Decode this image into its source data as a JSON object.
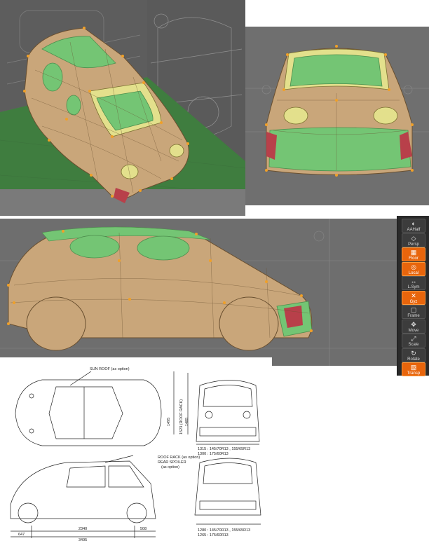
{
  "tool_shelf": {
    "items": [
      {
        "label": "AAHalf",
        "icon": "half-icon"
      },
      {
        "label": "Persp",
        "icon": "perspective-icon"
      },
      {
        "label": "Floor",
        "icon": "floor-icon",
        "active": true
      },
      {
        "label": "Local",
        "icon": "local-icon",
        "active": true
      },
      {
        "label": "L.Sym",
        "icon": "symmetry-icon"
      },
      {
        "label": "Gyz",
        "icon": "axis-icon",
        "active": true
      },
      {
        "label": "Frame",
        "icon": "frame-icon"
      },
      {
        "label": "Move",
        "icon": "move-icon"
      },
      {
        "label": "Scale",
        "icon": "scale-icon"
      },
      {
        "label": "Rotate",
        "icon": "rotate-icon"
      },
      {
        "label": "Transp",
        "icon": "transparency-icon",
        "active": true
      }
    ]
  },
  "reference_drawing": {
    "labels": {
      "sun_roof": "SUN ROOF (as option)",
      "roof_rack": "ROOF RACK (as option)",
      "rear_spoiler": "REAR SPOILER",
      "rear_spoiler_note": "(as option)"
    },
    "dimensions": {
      "height_1": "1495",
      "height_2": "1523 (ROOF RACK)",
      "height_3": "1485",
      "front_track_1": "1315 : 145/70R13 , 155/65R13",
      "front_track_2": "1300 : 175/60R13",
      "rear_track_1": "1280 : 145/70R13 , 155/65R13",
      "rear_track_2": "1265 : 175/60R13",
      "front_overhang": "647",
      "wheelbase": "2340",
      "rear_overhang": "508",
      "overall_length": "3495"
    }
  },
  "colors": {
    "viewport_bg": "#6e6e6e",
    "floor_green": "#3f7d3f",
    "body_tan": "#c9a67a",
    "glass_green": "#74c574",
    "highlight_yellow": "#e3e08c",
    "control_point": "#f0a028",
    "accent_orange": "#e8650c"
  }
}
